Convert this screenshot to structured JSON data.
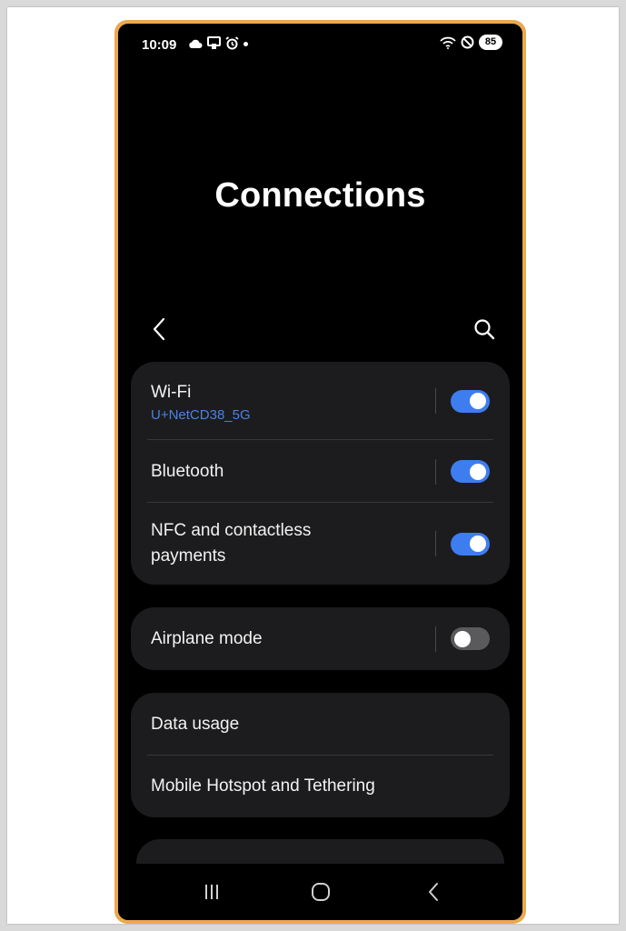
{
  "status_bar": {
    "time": "10:09",
    "left_icons": [
      "cloud-icon",
      "cast-icon",
      "alarm-icon",
      "notification-dot"
    ],
    "right_icons": [
      "wifi-icon",
      "do-not-disturb-icon"
    ],
    "battery": "85"
  },
  "header": {
    "title": "Connections"
  },
  "toolbar": {
    "back_icon": "chevron-left-icon",
    "search_icon": "search-icon"
  },
  "groups": [
    {
      "items": [
        {
          "label": "Wi-Fi",
          "sublabel": "U+NetCD38_5G",
          "toggle": true
        },
        {
          "label": "Bluetooth",
          "toggle": true
        },
        {
          "label": "NFC and contactless payments",
          "toggle": true
        }
      ]
    },
    {
      "items": [
        {
          "label": "Airplane mode",
          "toggle": false
        }
      ]
    },
    {
      "items": [
        {
          "label": "Data usage"
        },
        {
          "label": "Mobile Hotspot and Tethering"
        }
      ]
    }
  ],
  "nav_bar": {
    "buttons": [
      "recent-apps-icon",
      "home-icon",
      "back-icon"
    ]
  },
  "colors": {
    "accent": "#3e7df0",
    "sublabel": "#4b82e0",
    "card": "#1c1c1e",
    "frame": "#e9a94e"
  }
}
